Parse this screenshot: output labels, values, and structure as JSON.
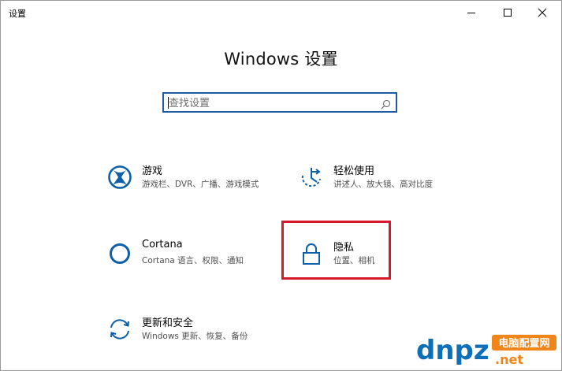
{
  "window": {
    "title": "设置",
    "controls": {
      "minimize": "minimize-icon",
      "maximize": "maximize-icon",
      "close": "close-icon"
    }
  },
  "main": {
    "heading": "Windows 设置",
    "search": {
      "placeholder": "查找设置",
      "value": "",
      "icon": "search-icon"
    },
    "categories": [
      {
        "name": "游戏",
        "desc": "游戏栏、DVR、广播、游戏模式",
        "icon": "xbox-icon"
      },
      {
        "name": "轻松使用",
        "desc": "讲述人、放大镜、高对比度",
        "icon": "ease-of-access-icon"
      },
      {
        "name": "Cortana",
        "desc": "Cortana 语言、权限、通知",
        "icon": "cortana-icon"
      },
      {
        "name": "隐私",
        "desc": "位置、相机",
        "icon": "lock-icon"
      },
      {
        "name": "更新和安全",
        "desc": "Windows 更新、恢复、备份",
        "icon": "update-icon"
      }
    ]
  },
  "watermark": {
    "brand": "dnpz",
    "suffix": ".net",
    "tagline": "电脑配置网"
  },
  "colors": {
    "accent": "#1e5aa8",
    "icon": "#0d5fa7",
    "highlight": "#d7172c",
    "watermark_blue": "#0d6fb8",
    "watermark_orange": "#f08519"
  }
}
